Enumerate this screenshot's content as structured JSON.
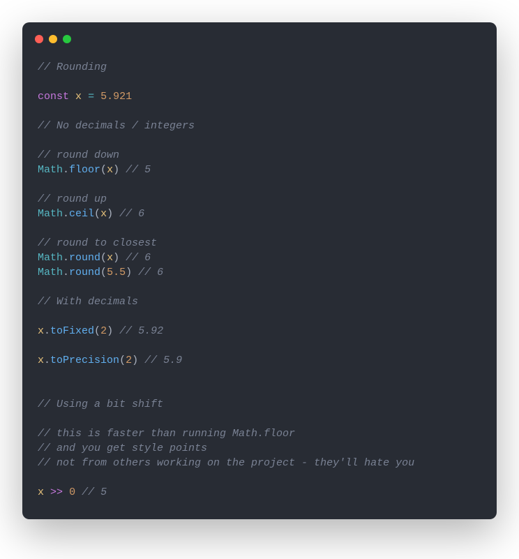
{
  "code": {
    "comments": {
      "rounding": "// Rounding",
      "nodecimals": "// No decimals / integers",
      "rounddown": "// round down",
      "roundup": "// round up",
      "roundclosest": "// round to closest",
      "withdecimals": "// With decimals",
      "bitshift": "// Using a bit shift",
      "faster": "// this is faster than running Math.floor",
      "style": "// and you get style points",
      "hate": "// not from others working on the project - they'll hate you",
      "r5a": "// 5",
      "r6a": "// 6",
      "r6b": "// 6",
      "r6c": "// 6",
      "r592": "// 5.92",
      "r59": "// 5.9",
      "r5b": "// 5"
    },
    "keywords": {
      "const": "const",
      "shift": ">>"
    },
    "eq": "=",
    "identifiers": {
      "x": "x",
      "Math": "Math"
    },
    "methods": {
      "floor": "floor",
      "ceil": "ceil",
      "round": "round",
      "toFixed": "toFixed",
      "toPrecision": "toPrecision"
    },
    "numbers": {
      "n5921": "5.921",
      "n55": "5.5",
      "n2": "2",
      "n0": "0"
    },
    "punct": {
      "dot": ".",
      "lp": "(",
      "rp": ")"
    }
  }
}
